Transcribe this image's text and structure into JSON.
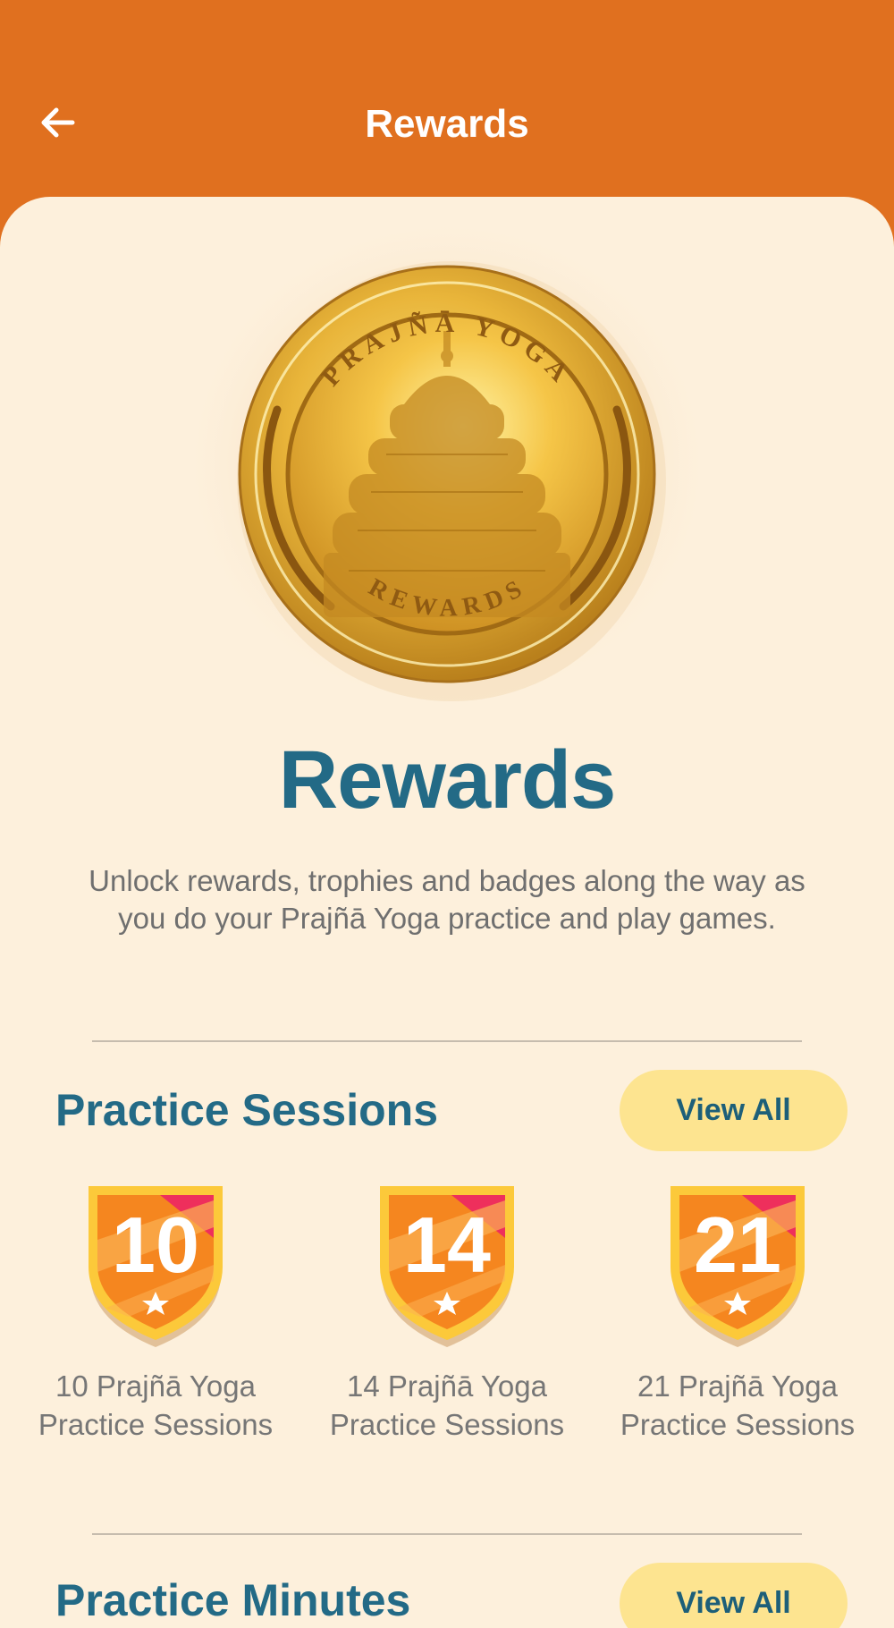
{
  "header": {
    "title": "Rewards"
  },
  "coin": {
    "top_text": "PRAJÑĀ YOGA",
    "bottom_text": "REWARDS"
  },
  "hero": {
    "title": "Rewards",
    "description": "Unlock rewards, trophies and badges along the way as you do your Prajñā Yoga practice and play games."
  },
  "sections": [
    {
      "title": "Practice Sessions",
      "view_all_label": "View All",
      "badges": [
        {
          "number": "10",
          "label": "10 Prajñā Yoga Practice Sessions"
        },
        {
          "number": "14",
          "label": "14 Prajñā Yoga Practice Sessions"
        },
        {
          "number": "21",
          "label": "21 Prajñā Yoga Practice Sessions"
        }
      ]
    },
    {
      "title": "Practice Minutes",
      "view_all_label": "View All"
    }
  ],
  "colors": {
    "header_bg": "#e0701f",
    "page_bg": "#fdf0dc",
    "title_blue": "#236a86",
    "button_bg": "#fde490"
  }
}
